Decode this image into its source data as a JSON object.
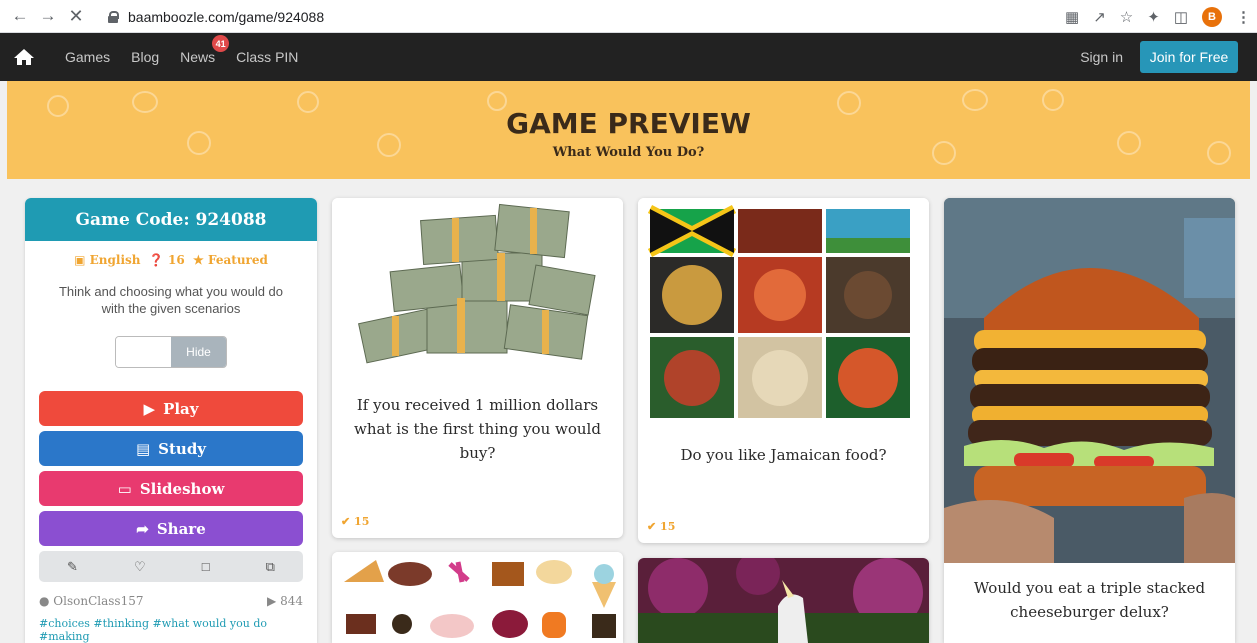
{
  "browser": {
    "url": "baamboozle.com/game/924088",
    "avatar_letter": "B"
  },
  "navbar": {
    "links": [
      "Games",
      "Blog",
      "News",
      "Class PIN"
    ],
    "news_badge": "41",
    "signin": "Sign in",
    "join": "Join for Free"
  },
  "banner": {
    "title": "GAME PREVIEW",
    "subtitle": "What Would You Do?"
  },
  "sidebar": {
    "game_code": "Game Code: 924088",
    "language": "English",
    "question_count": "16",
    "featured": "Featured",
    "description": "Think and choosing what you would do with the given scenarios",
    "toggle_label": "Hide",
    "play": "Play",
    "study": "Study",
    "slideshow": "Slideshow",
    "share": "Share",
    "author": "OlsonClass157",
    "plays": "844",
    "tags": "#choices #thinking #what would you do #making"
  },
  "cards": [
    {
      "question": "If you received 1 million dollars what is the first thing you would buy?",
      "count": "15"
    },
    {
      "question": "Do you like Jamaican food?",
      "count": "15"
    },
    {
      "question": "Would you eat a triple stacked cheeseburger delux?"
    }
  ],
  "colors": {
    "banner": "#f9c25c",
    "teal": "#1f9bb3",
    "play": "#ef4a3c",
    "study": "#2b77c9",
    "slideshow": "#e83a6f",
    "share": "#8b4fd1"
  }
}
